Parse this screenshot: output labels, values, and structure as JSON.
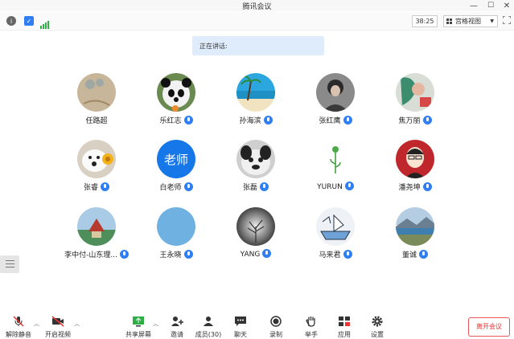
{
  "window": {
    "title": "腾讯会议",
    "minimize": "—",
    "maximize": "☐",
    "close": "✕"
  },
  "status": {
    "timer": "38:25",
    "view_label": "宫格视图"
  },
  "speaking": {
    "label": "正在讲话:"
  },
  "participants": [
    {
      "name": "任路超",
      "mic": false,
      "avatar": "sand-sketch"
    },
    {
      "name": "乐红志",
      "mic": true,
      "avatar": "panda"
    },
    {
      "name": "孙海滨",
      "mic": true,
      "avatar": "beach"
    },
    {
      "name": "张红鹰",
      "mic": true,
      "avatar": "person-dark"
    },
    {
      "name": "焦万丽",
      "mic": true,
      "avatar": "painting"
    },
    {
      "name": "张睿",
      "mic": true,
      "avatar": "dog-flower"
    },
    {
      "name": "白老师",
      "mic": true,
      "avatar": "text-avatar",
      "avatar_text": "老师"
    },
    {
      "name": "张磊",
      "mic": true,
      "avatar": "bulldog"
    },
    {
      "name": "YURUN",
      "mic": true,
      "avatar": "rose"
    },
    {
      "name": "潘尧坤",
      "mic": true,
      "avatar": "cartoon-man"
    },
    {
      "name": "李中付-山东理...",
      "mic": true,
      "avatar": "pagoda"
    },
    {
      "name": "王永晓",
      "mic": true,
      "avatar": "sky-blue"
    },
    {
      "name": "YANG",
      "mic": true,
      "avatar": "tree-bw"
    },
    {
      "name": "马来君",
      "mic": true,
      "avatar": "boat-drawing"
    },
    {
      "name": "董诚",
      "mic": true,
      "avatar": "lake"
    }
  ],
  "toolbar": {
    "unmute": "解除静音",
    "start_video": "开启视频",
    "share_screen": "共享屏幕",
    "invite": "邀请",
    "members": "成员(30)",
    "chat": "聊天",
    "record": "录制",
    "raise_hand": "举手",
    "apps": "应用",
    "settings": "设置",
    "leave": "离开会议"
  },
  "colors": {
    "accent": "#2f7ff2",
    "leave": "#e33333",
    "speaking_bg": "#dfecfc"
  }
}
